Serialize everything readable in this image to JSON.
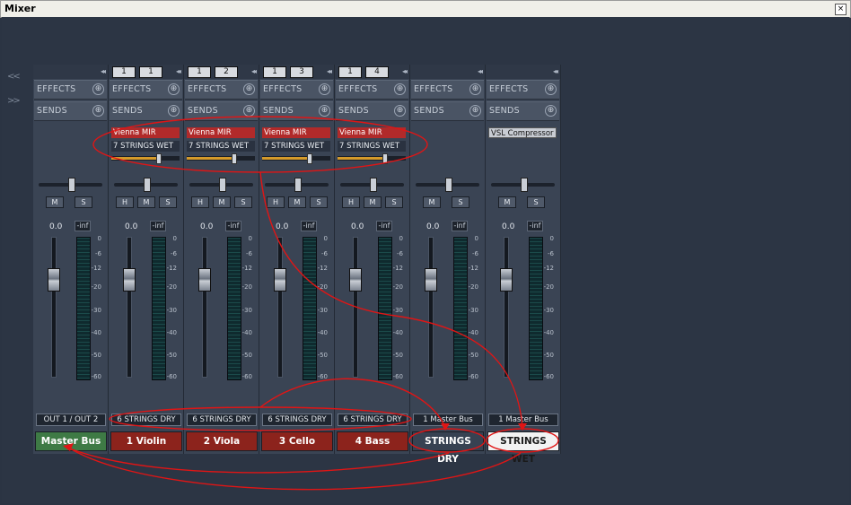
{
  "window": {
    "title": "Mixer",
    "close_icon": "×"
  },
  "nav": {
    "left": "<<",
    "right": ">>"
  },
  "labels": {
    "effects": "EFFECTS",
    "sends": "SENDS",
    "mute": "M",
    "solo": "S",
    "rec": "H",
    "collapse": "◂◂",
    "plus": "⊕"
  },
  "ticks": [
    "0",
    "-6",
    "-12",
    "-20",
    "-30",
    "-40",
    "-50",
    "-60"
  ],
  "strips": [
    {
      "name": "Master Bus",
      "output": "OUT 1 / OUT 2",
      "nums": [],
      "volume": "0.0",
      "peak": "-inf",
      "color": "green",
      "inserts": []
    },
    {
      "name": "1 Violin",
      "output": "6 STRINGS DRY",
      "nums": [
        "1",
        "1"
      ],
      "volume": "0.0",
      "peak": "-inf",
      "color": "red",
      "inserts": [
        {
          "label": "Vienna MIR",
          "style": "red"
        },
        {
          "label": "7 STRINGS WET",
          "style": "dark"
        }
      ]
    },
    {
      "name": "2 Viola",
      "output": "6 STRINGS DRY",
      "nums": [
        "1",
        "2"
      ],
      "volume": "0.0",
      "peak": "-inf",
      "color": "red",
      "inserts": [
        {
          "label": "Vienna MIR",
          "style": "red"
        },
        {
          "label": "7 STRINGS WET",
          "style": "dark"
        }
      ]
    },
    {
      "name": "3 Cello",
      "output": "6 STRINGS DRY",
      "nums": [
        "1",
        "3"
      ],
      "volume": "0.0",
      "peak": "-inf",
      "color": "red",
      "inserts": [
        {
          "label": "Vienna MIR",
          "style": "red"
        },
        {
          "label": "7 STRINGS WET",
          "style": "dark"
        }
      ]
    },
    {
      "name": "4 Bass",
      "output": "6 STRINGS DRY",
      "nums": [
        "1",
        "4"
      ],
      "volume": "0.0",
      "peak": "-inf",
      "color": "red",
      "inserts": [
        {
          "label": "Vienna MIR",
          "style": "red"
        },
        {
          "label": "7 STRINGS WET",
          "style": "dark"
        }
      ]
    },
    {
      "name": "STRINGS DRY",
      "output": "1 Master Bus",
      "nums": [],
      "volume": "0.0",
      "peak": "-inf",
      "color": "dark",
      "inserts": []
    },
    {
      "name": "STRINGS WET",
      "output": "1 Master Bus",
      "nums": [],
      "volume": "0.0",
      "peak": "-inf",
      "color": "white",
      "inserts": [
        {
          "label": "VSL Compressor",
          "style": "grey"
        }
      ]
    }
  ]
}
